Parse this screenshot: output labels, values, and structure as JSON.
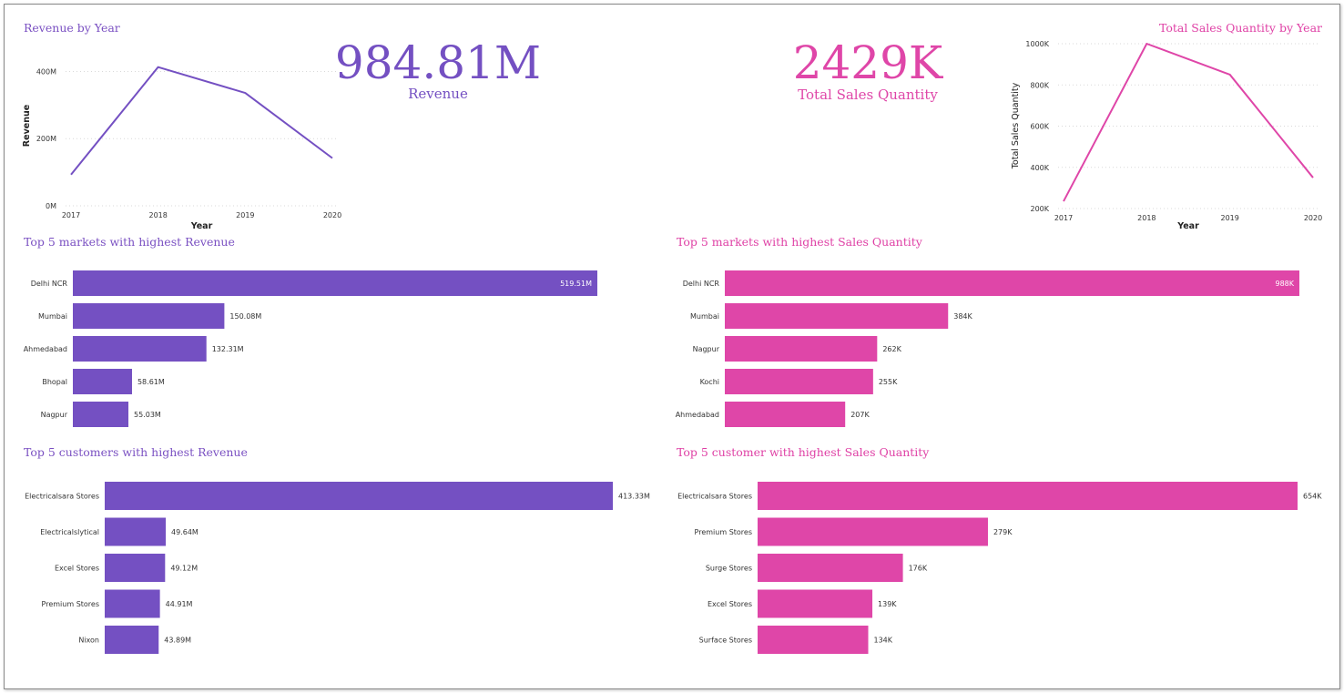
{
  "colors": {
    "purple": "#7450c2",
    "pink": "#df46a8",
    "grid": "#d9d9d9",
    "text": "#333333"
  },
  "kpis": {
    "revenue": {
      "value": "984.81M",
      "label": "Revenue"
    },
    "quantity": {
      "value": "2429K",
      "label": "Total Sales Quantity"
    }
  },
  "chart_data": [
    {
      "id": "revenue_by_year",
      "type": "line",
      "title": "Revenue by Year",
      "xlabel": "Year",
      "ylabel": "Revenue",
      "x": [
        "2017",
        "2018",
        "2019",
        "2020"
      ],
      "values": [
        93,
        413,
        336,
        142
      ],
      "ylim": [
        0,
        450
      ],
      "yticks": [
        0,
        200,
        400
      ],
      "ytick_labels": [
        "0M",
        "200M",
        "400M"
      ],
      "grid": true,
      "color": "#7450c2"
    },
    {
      "id": "quantity_by_year",
      "type": "line",
      "title": "Total Sales Quantity by Year",
      "xlabel": "Year",
      "ylabel": "Total Sales Quantity",
      "x": [
        "2017",
        "2018",
        "2019",
        "2020"
      ],
      "values": [
        235,
        1000,
        850,
        350
      ],
      "ylim": [
        200,
        1000
      ],
      "yticks": [
        200,
        400,
        600,
        800,
        1000
      ],
      "ytick_labels": [
        "200K",
        "400K",
        "600K",
        "800K",
        "1000K"
      ],
      "grid": true,
      "color": "#df46a8"
    },
    {
      "id": "top_markets_revenue",
      "type": "bar",
      "orientation": "horizontal",
      "title": "Top 5 markets with highest Revenue",
      "categories": [
        "Delhi NCR",
        "Mumbai",
        "Ahmedabad",
        "Bhopal",
        "Nagpur"
      ],
      "values": [
        519.51,
        150.08,
        132.31,
        58.61,
        55.03
      ],
      "labels": [
        "519.51M",
        "150.08M",
        "132.31M",
        "58.61M",
        "55.03M"
      ],
      "color": "#7450c2"
    },
    {
      "id": "top_markets_quantity",
      "type": "bar",
      "orientation": "horizontal",
      "title": "Top 5 markets with highest Sales Quantity",
      "categories": [
        "Delhi NCR",
        "Mumbai",
        "Nagpur",
        "Kochi",
        "Ahmedabad"
      ],
      "values": [
        988,
        384,
        262,
        255,
        207
      ],
      "labels": [
        "988K",
        "384K",
        "262K",
        "255K",
        "207K"
      ],
      "color": "#df46a8"
    },
    {
      "id": "top_customers_revenue",
      "type": "bar",
      "orientation": "horizontal",
      "title": "Top 5 customers with highest Revenue",
      "categories": [
        "Electricalsara Stores",
        "Electricalslytical",
        "Excel Stores",
        "Premium Stores",
        "Nixon"
      ],
      "values": [
        413.33,
        49.64,
        49.12,
        44.91,
        43.89
      ],
      "labels": [
        "413.33M",
        "49.64M",
        "49.12M",
        "44.91M",
        "43.89M"
      ],
      "color": "#7450c2"
    },
    {
      "id": "top_customers_quantity",
      "type": "bar",
      "orientation": "horizontal",
      "title": "Top 5 customer with highest Sales Quantity",
      "categories": [
        "Electricalsara Stores",
        "Premium Stores",
        "Surge Stores",
        "Excel Stores",
        "Surface Stores"
      ],
      "values": [
        654,
        279,
        176,
        139,
        134
      ],
      "labels": [
        "654K",
        "279K",
        "176K",
        "139K",
        "134K"
      ],
      "color": "#df46a8"
    }
  ]
}
